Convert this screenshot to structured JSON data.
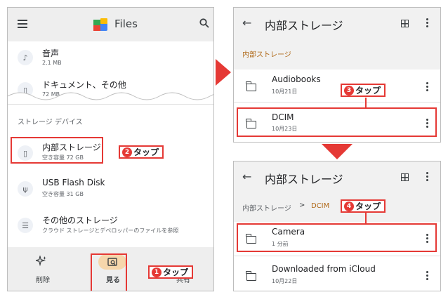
{
  "left": {
    "app_title": "Files",
    "files": [
      {
        "name": "音声",
        "size": "2.1 MB",
        "icon": "music-note-icon"
      },
      {
        "name": "ドキュメント、その他",
        "size": "72 MB",
        "icon": "document-icon"
      }
    ],
    "section_label": "ストレージ デバイス",
    "storage": [
      {
        "name": "内部ストレージ",
        "detail": "空き容量 72 GB",
        "icon": "phone-icon"
      },
      {
        "name": "USB Flash Disk",
        "detail": "空き容量 31 GB",
        "icon": "usb-icon"
      },
      {
        "name": "その他のストレージ",
        "detail": "クラウド ストレージとデベロッパーのファイルを参照",
        "icon": "list-icon"
      }
    ],
    "nav": [
      {
        "label": "削除",
        "icon": "sparkle-icon"
      },
      {
        "label": "見る",
        "icon": "browse-icon"
      },
      {
        "label": "共有",
        "icon": "share-icon"
      }
    ]
  },
  "right_top": {
    "title": "内部ストレージ",
    "breadcrumb": "内部ストレージ",
    "folders": [
      {
        "name": "Audiobooks",
        "date": "10月21日"
      },
      {
        "name": "DCIM",
        "date": "10月23日"
      }
    ]
  },
  "right_bottom": {
    "title": "内部ストレージ",
    "breadcrumb_root": "内部ストレージ",
    "breadcrumb_sep": ">",
    "breadcrumb_current": "DCIM",
    "folders": [
      {
        "name": "Camera",
        "date": "1 分前"
      },
      {
        "name": "Downloaded from iCloud",
        "date": "10月22日"
      }
    ]
  },
  "annotations": [
    {
      "num": "1",
      "text": "タップ"
    },
    {
      "num": "2",
      "text": "タップ"
    },
    {
      "num": "3",
      "text": "タップ"
    },
    {
      "num": "4",
      "text": "タップ"
    }
  ],
  "colors": {
    "highlight": "#e53935",
    "breadcrumb_accent": "#b06a1a",
    "nav_pill": "#f6d6ab"
  }
}
